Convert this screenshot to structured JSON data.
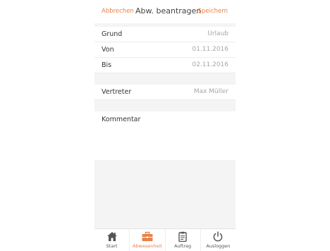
{
  "header": {
    "cancel_label": "Abbrechen",
    "title": "Abw. beantragen",
    "save_label": "Speichern"
  },
  "form": {
    "grund": {
      "label": "Grund",
      "value": "Urlaub"
    },
    "von": {
      "label": "Von",
      "value": "01.11.2016"
    },
    "bis": {
      "label": "Bis",
      "value": "02.11.2016"
    },
    "vertreter": {
      "label": "Vertreter",
      "value": "Max Müller"
    },
    "kommentar": {
      "label": "Kommentar",
      "value": ""
    }
  },
  "tabbar": {
    "items": [
      {
        "label": "Start",
        "icon": "home-icon"
      },
      {
        "label": "Abwesenheit",
        "icon": "briefcase-icon",
        "active": true
      },
      {
        "label": "Auftrag",
        "icon": "clipboard-icon"
      },
      {
        "label": "Ausloggen",
        "icon": "power-icon"
      }
    ]
  },
  "colors": {
    "accent": "#e8814a",
    "separator": "#f4f4f4",
    "label": "#333333",
    "value": "#a6a6a6"
  }
}
